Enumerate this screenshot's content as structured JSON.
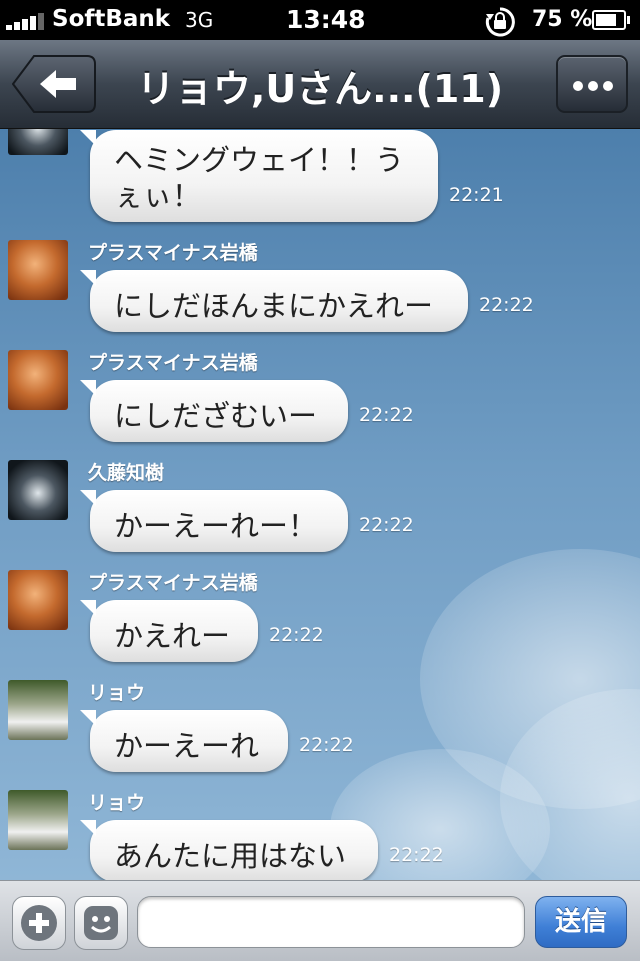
{
  "status_bar": {
    "carrier": "SoftBank",
    "network": "3G",
    "time": "13:48",
    "battery": "75 %",
    "battery_level": 0.75,
    "icons": [
      "signal-icon",
      "rotation-lock-icon",
      "battery-icon"
    ]
  },
  "nav": {
    "title": "リョウ,Uさん...(11)",
    "back_icon": "back-arrow-icon",
    "menu_icon": "more-icon"
  },
  "messages": [
    {
      "sender": "",
      "text": "ヘミングウェイ！！うぇぃ！",
      "time": "22:21",
      "avatar": "kudo"
    },
    {
      "sender": "プラスマイナス岩橋",
      "text": "にしだほんまにかえれー",
      "time": "22:22",
      "avatar": "plus"
    },
    {
      "sender": "プラスマイナス岩橋",
      "text": "にしだざむいー",
      "time": "22:22",
      "avatar": "plus"
    },
    {
      "sender": "久藤知樹",
      "text": "かーえーれー！",
      "time": "22:22",
      "avatar": "kudo"
    },
    {
      "sender": "プラスマイナス岩橋",
      "text": "かえれー",
      "time": "22:22",
      "avatar": "plus"
    },
    {
      "sender": "リョウ",
      "text": "かーえーれ",
      "time": "22:22",
      "avatar": "ryo"
    },
    {
      "sender": "リョウ",
      "text": "あんたに用はない",
      "time": "22:22",
      "avatar": "ryo"
    }
  ],
  "input_bar": {
    "add_icon": "plus-icon",
    "sticker_icon": "smiley-icon",
    "input_value": "",
    "send_label": "送信"
  }
}
